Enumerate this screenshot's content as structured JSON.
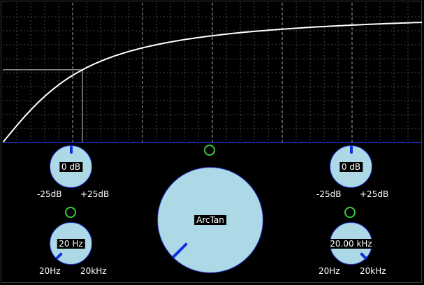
{
  "colors": {
    "background": "#000000",
    "knob_fill": "#add8e6",
    "knob_outline": "#2233cc",
    "pointer": "#1030e0",
    "curve": "#ffffff",
    "grid": "#5a5a5a",
    "led": "#3cc83c"
  },
  "graph": {
    "curve": "arctan transfer curve",
    "marker_level": 0.46
  },
  "left": {
    "gain": {
      "value": "0 dB",
      "min": "-25dB",
      "max": "+25dB",
      "level": 0.5
    },
    "freq": {
      "value": "20 Hz",
      "min": "20Hz",
      "max": "20kHz",
      "level": 0.0
    }
  },
  "center": {
    "shape": {
      "value": "ArcTan",
      "level": 0.0
    }
  },
  "right": {
    "gain": {
      "value": "0 dB",
      "min": "-25dB",
      "max": "+25dB",
      "level": 0.5
    },
    "freq": {
      "value": "20.00 kHz",
      "min": "20Hz",
      "max": "20kHz",
      "level": 1.0
    }
  }
}
